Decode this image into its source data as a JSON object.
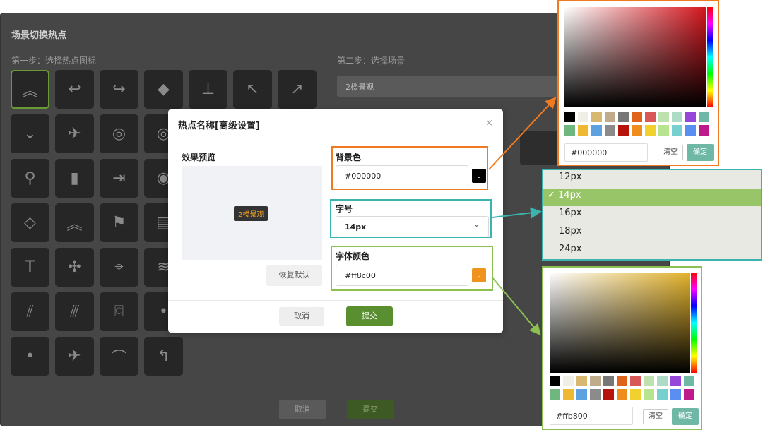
{
  "background_app": {
    "title": "场景切换热点",
    "step1": "第一步：选择热点图标",
    "step2": "第二步：选择场景",
    "scene_value": "2楼景观",
    "cancel_label": "取消",
    "submit_label": "提交"
  },
  "modal": {
    "title": "热点名称[高级设置]",
    "close": "×",
    "preview_label": "效果预览",
    "preview_tag": "2楼景观",
    "restore_label": "恢复默认",
    "bg_color_label": "背景色",
    "bg_color_value": "#000000",
    "font_size_label": "字号",
    "font_size_value": "14px",
    "font_color_label": "字体颜色",
    "font_color_value": "#ff8c00",
    "cancel_label": "取消",
    "submit_label": "提交"
  },
  "picker_bg": {
    "value": "#000000",
    "clear": "清空",
    "ok": "确定"
  },
  "picker_font": {
    "value": "#ffb800",
    "clear": "清空",
    "ok": "确定"
  },
  "size_options": [
    "12px",
    "✓ 14px",
    "16px",
    "18px",
    "24px"
  ],
  "colors": {
    "bg_highlight": "#f07a1f",
    "size_highlight": "#3bb3ae",
    "font_highlight": "#8cc152",
    "font_swatch": "#f0921e",
    "submit": "#5a8f2f"
  },
  "icons": [
    "chevron-up-double-icon",
    "back-arrow-icon",
    "forward-arrow-icon",
    "cube-icon",
    "pin-stand-icon",
    "cursor-up-left-icon",
    "cursor-up-right-icon",
    "chevron-down-icon",
    "helicopter-icon",
    "target-icon",
    "location-pin-icon",
    "tag-icon",
    "door-exit-icon",
    "warning-diamond-icon",
    "chevrons-up-icon",
    "flag-icon",
    "film-icon",
    "text-t-icon",
    "drone-icon",
    "map-pin-icon",
    "road-lanes-icon",
    "road-lanes-2-icon",
    "camera-icon",
    "dot-icon",
    "plane-icon",
    "bird-icon",
    "return-arrow-icon"
  ]
}
